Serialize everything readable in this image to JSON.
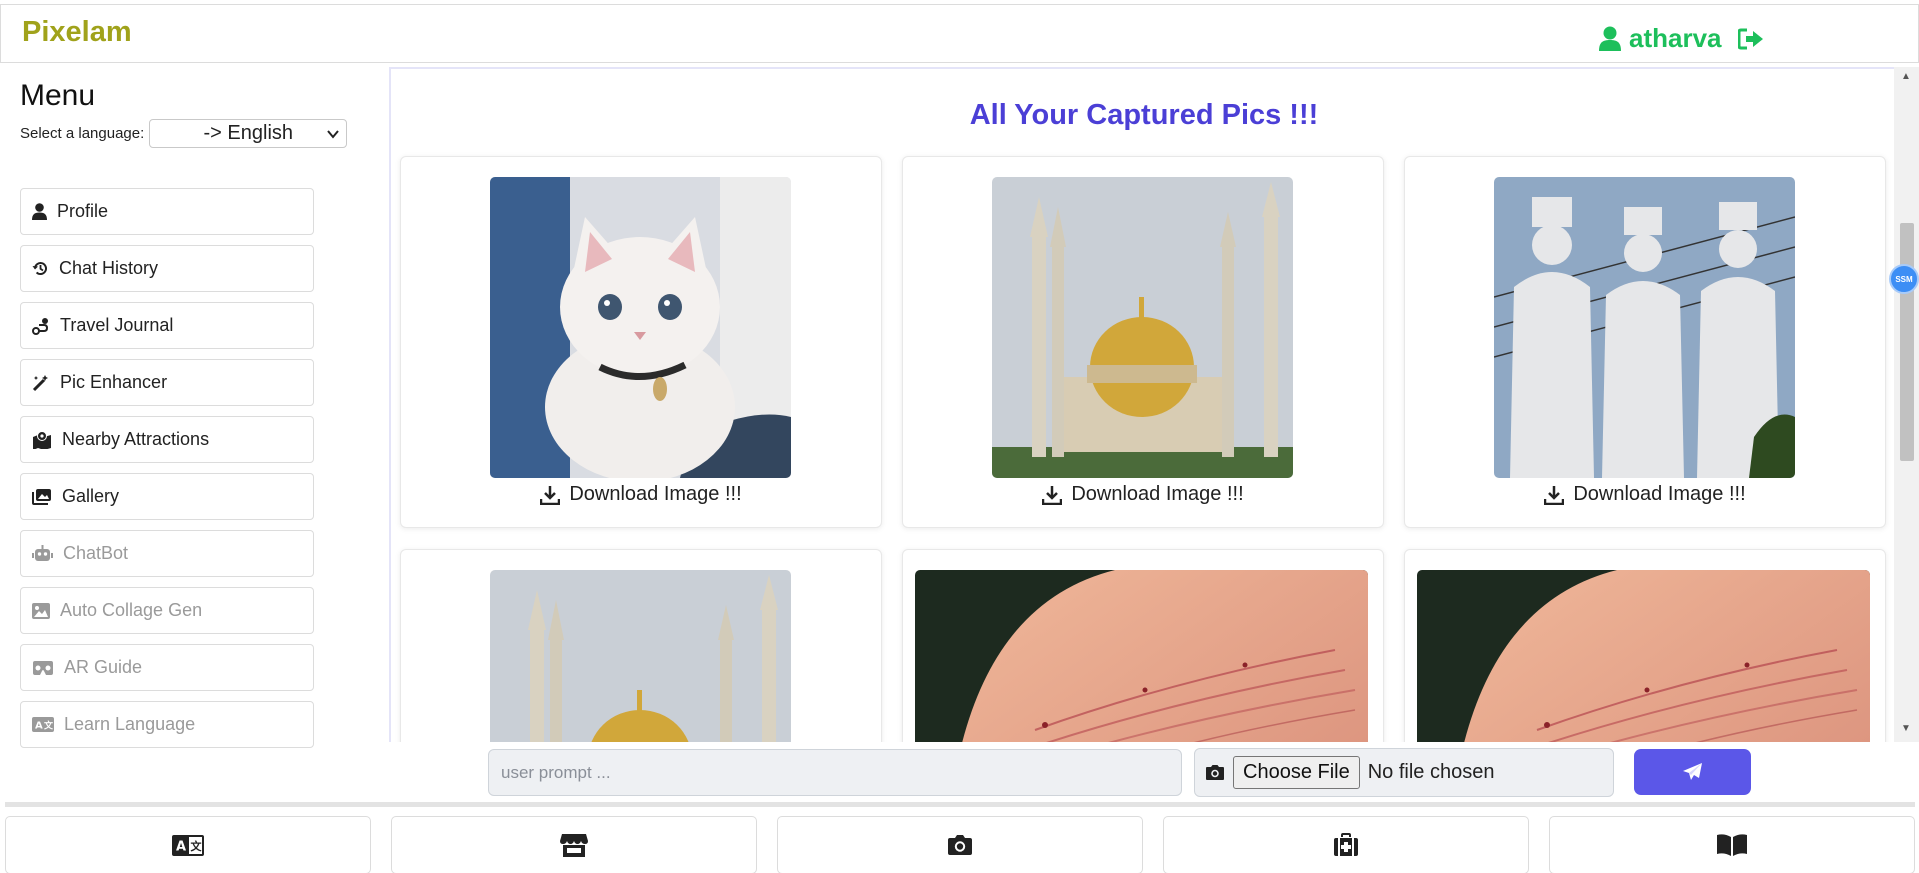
{
  "header": {
    "brand": "Pixelam",
    "username": "atharva"
  },
  "sidebar": {
    "title": "Menu",
    "language_label": "Select a language:",
    "language_value": "-> English",
    "items": [
      {
        "label": "Profile",
        "icon": "user-icon",
        "enabled": true
      },
      {
        "label": "Chat History",
        "icon": "history-icon",
        "enabled": true
      },
      {
        "label": "Travel Journal",
        "icon": "route-icon",
        "enabled": true
      },
      {
        "label": "Pic Enhancer",
        "icon": "magic-wand-icon",
        "enabled": true
      },
      {
        "label": "Nearby Attractions",
        "icon": "map-location-icon",
        "enabled": true
      },
      {
        "label": "Gallery",
        "icon": "images-icon",
        "enabled": true
      },
      {
        "label": "ChatBot",
        "icon": "robot-icon",
        "enabled": false
      },
      {
        "label": "Auto Collage Gen",
        "icon": "image-icon",
        "enabled": false
      },
      {
        "label": "AR Guide",
        "icon": "vr-cardboard-icon",
        "enabled": false
      },
      {
        "label": "Learn Language",
        "icon": "language-icon",
        "enabled": false
      }
    ]
  },
  "main": {
    "title": "All Your Captured Pics !!!",
    "cards": [
      {
        "subject": "kitten",
        "download_label": "Download Image !!!"
      },
      {
        "subject": "mosque",
        "download_label": "Download Image !!!"
      },
      {
        "subject": "statues",
        "download_label": "Download Image !!!"
      },
      {
        "subject": "mosque"
      },
      {
        "subject": "skin"
      },
      {
        "subject": "skin"
      }
    ]
  },
  "prompt": {
    "placeholder": "user prompt ...",
    "choose_file_label": "Choose File",
    "file_status": "No file chosen"
  },
  "scroll_badge": "SSM",
  "bottom_tabs": [
    "language-icon",
    "store-icon",
    "camera-icon",
    "medkit-icon",
    "book-open-icon"
  ],
  "colors": {
    "brand": "#a0a21b",
    "user": "#1dbf5b",
    "title": "#4b3fd6",
    "send_button": "#5b57e8"
  }
}
